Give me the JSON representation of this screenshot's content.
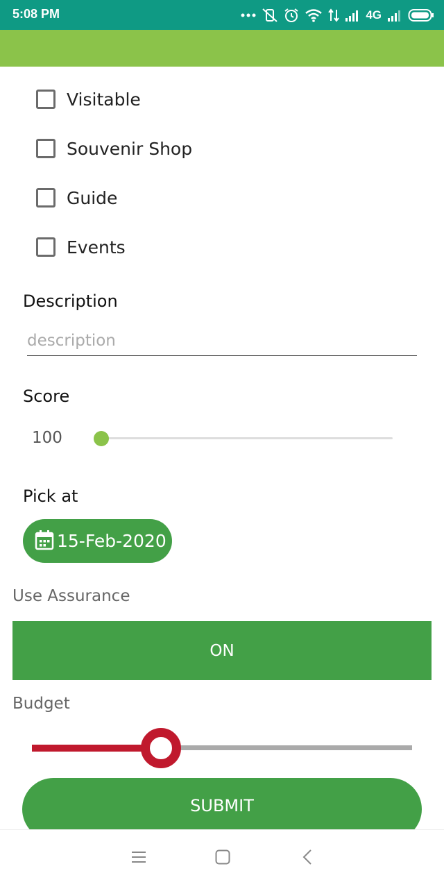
{
  "status_bar": {
    "time": "5:08 PM",
    "network_label": "4G",
    "icons": [
      "dots-icon",
      "vibrate-off-icon",
      "alarm-icon",
      "wifi-icon",
      "data-transfer-icon",
      "signal-icon",
      "signal-icon",
      "battery-icon"
    ]
  },
  "app_bar": {
    "color": "#8bc34a"
  },
  "checkboxes": [
    {
      "label": "Visitable",
      "checked": false
    },
    {
      "label": "Souvenir Shop",
      "checked": false
    },
    {
      "label": "Guide",
      "checked": false
    },
    {
      "label": "Events",
      "checked": false
    }
  ],
  "description": {
    "label": "Description",
    "placeholder": "description",
    "value": ""
  },
  "score": {
    "label": "Score",
    "value": "100",
    "fraction": 0.0,
    "thumb_color": "#8bc34a"
  },
  "pick_at": {
    "label": "Pick at",
    "date": "15-Feb-2020",
    "icon": "calendar-icon"
  },
  "assurance": {
    "label": "Use Assurance",
    "button_label": "ON"
  },
  "budget": {
    "label": "Budget",
    "fraction": 0.34,
    "active_color": "#c0192d"
  },
  "submit": {
    "label": "SUBMIT"
  },
  "nav_bar": {
    "icons": [
      "menu-icon",
      "home-icon",
      "back-icon"
    ]
  },
  "colors": {
    "primary_dark": "#0f9a84",
    "accent_green": "#43a047"
  }
}
